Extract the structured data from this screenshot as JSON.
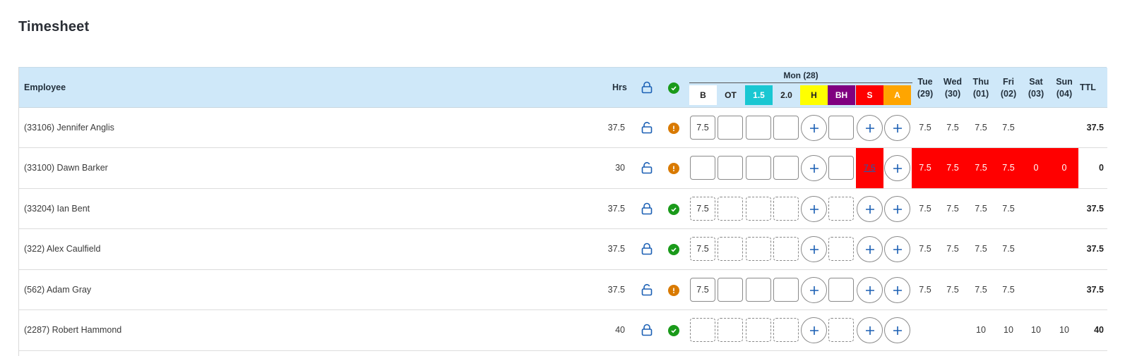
{
  "page": {
    "title": "Timesheet"
  },
  "colors": {
    "header_bg": "#cfe8f9",
    "ok": "#1a9a1a",
    "warn": "#d97a00",
    "sick": "#ff0000",
    "link": "#1a5fb4",
    "icon_blue": "#1a5fb4"
  },
  "header": {
    "employee": "Employee",
    "hrs": "Hrs",
    "ttl": "TTL",
    "mon": "Mon (28)",
    "categories": [
      {
        "label": "B",
        "bg": "#ffffff",
        "color": "#222222"
      },
      {
        "label": "OT",
        "bg": "#cfe8f9",
        "color": "#222222"
      },
      {
        "label": "1.5",
        "bg": "#19c7d2",
        "color": "#ffffff"
      },
      {
        "label": "2.0",
        "bg": "#cfe8f9",
        "color": "#222222"
      },
      {
        "label": "H",
        "bg": "#ffff00",
        "color": "#222222"
      },
      {
        "label": "BH",
        "bg": "#800080",
        "color": "#ffffff"
      },
      {
        "label": "S",
        "bg": "#ff0000",
        "color": "#ffffff"
      },
      {
        "label": "A",
        "bg": "#ffa500",
        "color": "#ffffff"
      }
    ],
    "days": [
      {
        "name": "Tue",
        "date": "(29)"
      },
      {
        "name": "Wed",
        "date": "(30)"
      },
      {
        "name": "Thu",
        "date": "(01)"
      },
      {
        "name": "Fri",
        "date": "(02)"
      },
      {
        "name": "Sat",
        "date": "(03)"
      },
      {
        "name": "Sun",
        "date": "(04)"
      }
    ]
  },
  "rows": [
    {
      "employee": "(33106) Jennifer Anglis",
      "hrs": "37.5",
      "lock": "unlocked",
      "status": "warn",
      "mon_b": "7.5",
      "boxes": "solid",
      "sick_value": "",
      "days": [
        "7.5",
        "7.5",
        "7.5",
        "7.5",
        "",
        ""
      ],
      "ttl": "37.5"
    },
    {
      "employee": "(33100) Dawn Barker",
      "hrs": "30",
      "lock": "unlocked",
      "status": "warn",
      "mon_b": "",
      "boxes": "solid",
      "sick_value": "7.5",
      "days": [
        "7.5",
        "7.5",
        "7.5",
        "7.5",
        "0",
        "0"
      ],
      "ttl": "0"
    },
    {
      "employee": "(33204) Ian Bent",
      "hrs": "37.5",
      "lock": "locked",
      "status": "ok",
      "mon_b": "7.5",
      "boxes": "dashed",
      "sick_value": "",
      "days": [
        "7.5",
        "7.5",
        "7.5",
        "7.5",
        "",
        ""
      ],
      "ttl": "37.5"
    },
    {
      "employee": "(322) Alex Caulfield",
      "hrs": "37.5",
      "lock": "locked",
      "status": "ok",
      "mon_b": "7.5",
      "boxes": "dashed",
      "sick_value": "",
      "days": [
        "7.5",
        "7.5",
        "7.5",
        "7.5",
        "",
        ""
      ],
      "ttl": "37.5"
    },
    {
      "employee": "(562) Adam Gray",
      "hrs": "37.5",
      "lock": "unlocked",
      "status": "warn",
      "mon_b": "7.5",
      "boxes": "solid",
      "sick_value": "",
      "days": [
        "7.5",
        "7.5",
        "7.5",
        "7.5",
        "",
        ""
      ],
      "ttl": "37.5"
    },
    {
      "employee": "(2287) Robert Hammond",
      "hrs": "40",
      "lock": "locked",
      "status": "ok",
      "mon_b": "",
      "boxes": "dashed",
      "sick_value": "",
      "days": [
        "",
        "",
        "10",
        "10",
        "10",
        "10"
      ],
      "ttl": "40"
    }
  ]
}
